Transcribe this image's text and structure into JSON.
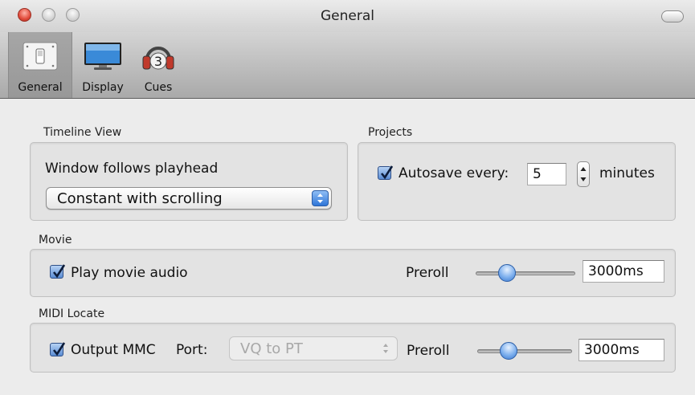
{
  "window": {
    "title": "General"
  },
  "toolbar": {
    "items": [
      {
        "label": "General",
        "icon": "general-switch-icon",
        "selected": true
      },
      {
        "label": "Display",
        "icon": "display-monitor-icon",
        "selected": false
      },
      {
        "label": "Cues",
        "icon": "cues-headphones-icon",
        "selected": false
      }
    ],
    "cues_icon_number": "3"
  },
  "timeline_view": {
    "label": "Timeline View",
    "follow_label": "Window follows playhead",
    "mode_value": "Constant with scrolling"
  },
  "projects": {
    "label": "Projects",
    "autosave_checked": true,
    "autosave_label": "Autosave every:",
    "autosave_value": "5",
    "unit_label": "minutes"
  },
  "movie": {
    "label": "Movie",
    "play_audio_checked": true,
    "play_audio_label": "Play movie audio",
    "preroll_label": "Preroll",
    "preroll_slider_fraction": 0.33,
    "preroll_value": "3000ms"
  },
  "midi_locate": {
    "label": "MIDI Locate",
    "output_mmc_checked": true,
    "output_mmc_label": "Output MMC",
    "port_label": "Port:",
    "port_value": "VQ to PT",
    "port_enabled": false,
    "preroll_label": "Preroll",
    "preroll_slider_fraction": 0.33,
    "preroll_value": "3000ms"
  },
  "colors": {
    "accent": "#3b79cf",
    "window_bg": "#ececec"
  }
}
